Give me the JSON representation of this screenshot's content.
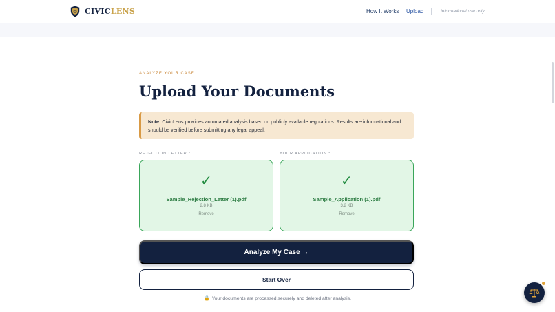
{
  "brand": {
    "name_part1": "CIVIC",
    "name_part2": "LENS",
    "icon": "shield-logo-icon",
    "accent_color": "#c9a24a",
    "primary_color": "#13213f"
  },
  "nav": {
    "links": [
      {
        "label": "How It Works"
      },
      {
        "label": "Upload"
      }
    ],
    "info": "Informational use only"
  },
  "main": {
    "eyebrow": "ANALYZE YOUR CASE",
    "title": "Upload Your Documents",
    "note": {
      "label": "Note:",
      "text": " CivicLens provides automated analysis based on publicly available regulations. Results are informational and should be verified before submitting any legal appeal."
    },
    "uploads": [
      {
        "label": "REJECTION LETTER *",
        "check_icon": "checkmark-icon",
        "check": "✓",
        "filename": "Sample_Rejection_Letter (1).pdf",
        "size": "2.8 KB",
        "remove": "Remove"
      },
      {
        "label": "YOUR APPLICATION *",
        "check_icon": "checkmark-icon",
        "check": "✓",
        "filename": "Sample_Application (1).pdf",
        "size": "3.2 KB",
        "remove": "Remove"
      }
    ],
    "analyze_button": "Analyze My Case →",
    "start_over_button": "Start Over",
    "secure_note": "Your documents are processed securely and deleted after analysis.",
    "lock_icon": "🔒"
  },
  "fab": {
    "icon": "scales-of-justice-icon",
    "badge_color": "#e0a33a"
  }
}
